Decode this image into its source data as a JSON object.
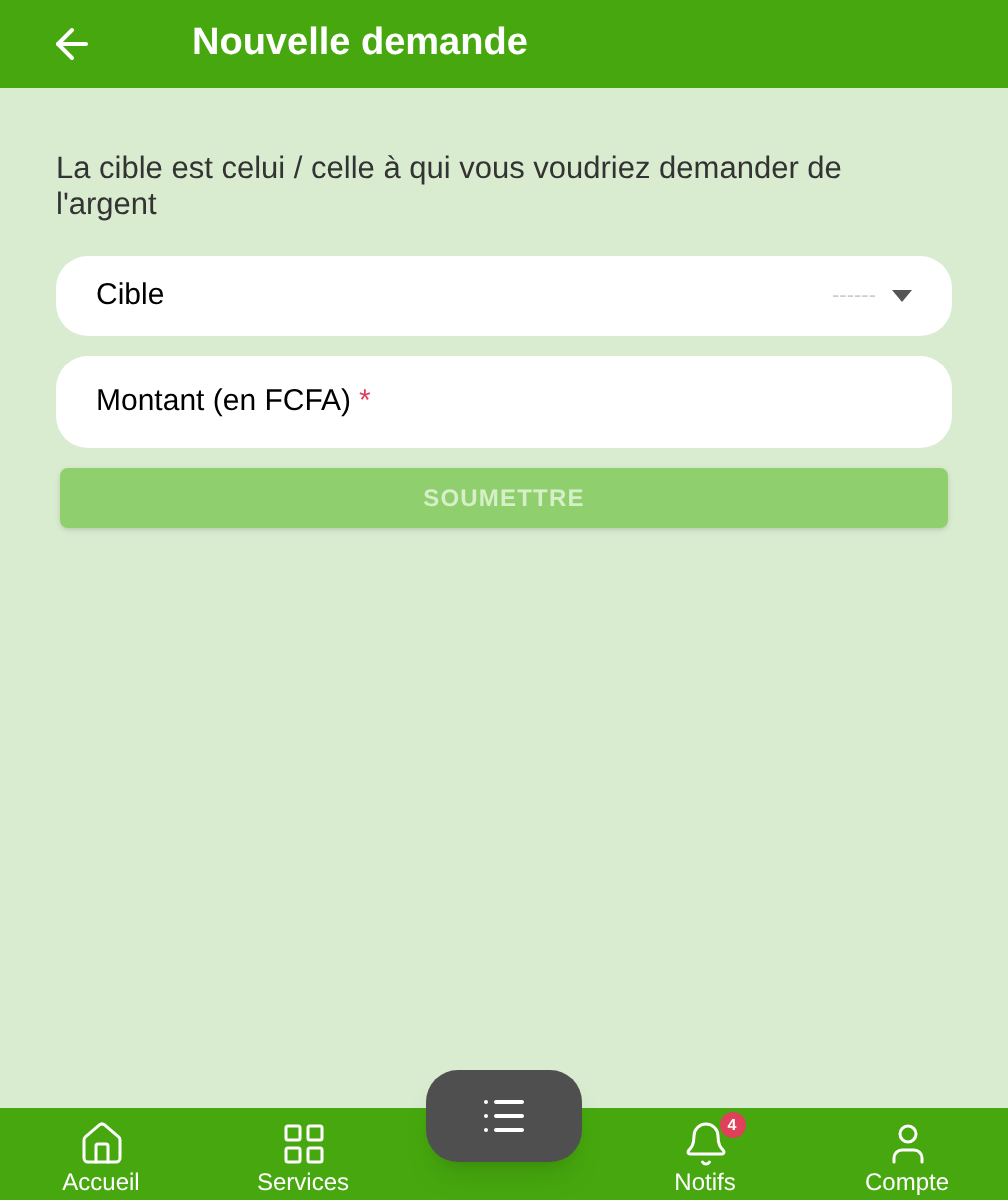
{
  "header": {
    "title": "Nouvelle demande"
  },
  "intro": "La cible est celui / celle à qui vous voudriez demander de l'argent",
  "target_select": {
    "label": "Cible",
    "value": "------"
  },
  "amount_field": {
    "placeholder": "Montant (en FCFA)",
    "required_mark": "*"
  },
  "submit": {
    "label": "SOUMETTRE",
    "disabled": true
  },
  "nav": [
    {
      "kind": "home",
      "label": "Accueil"
    },
    {
      "kind": "grid",
      "label": "Services"
    },
    {
      "kind": "fab"
    },
    {
      "kind": "bell",
      "label": "Notifs",
      "badge": "4"
    },
    {
      "kind": "user",
      "label": "Compte"
    }
  ]
}
